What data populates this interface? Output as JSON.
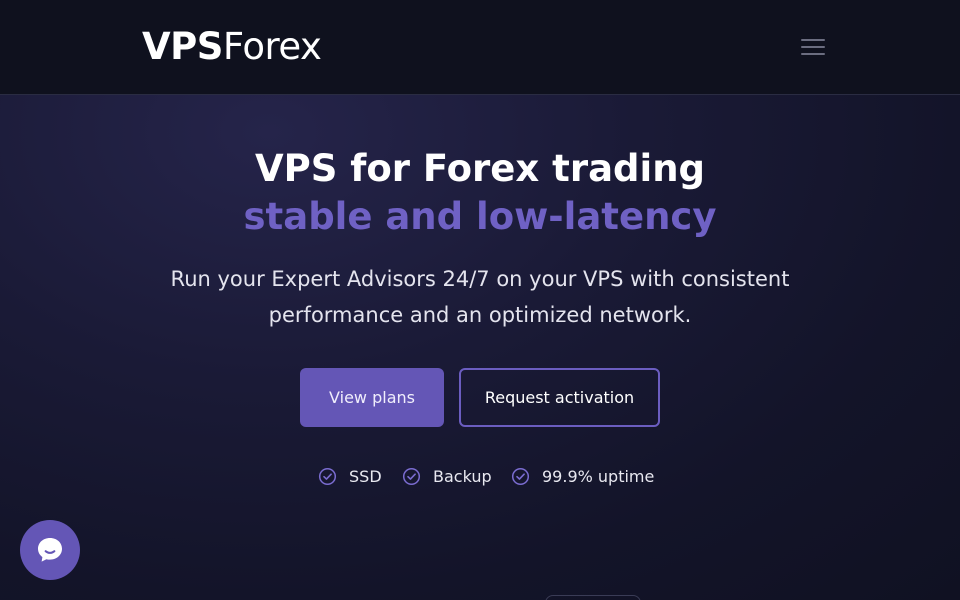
{
  "header": {
    "logo_bold": "VPS",
    "logo_light": "Forex",
    "menu_icon": "hamburger-menu-icon"
  },
  "hero": {
    "headline": "VPS for Forex trading",
    "headline_accent": "stable and low-latency",
    "subtext": "Run your Expert Advisors 24/7 on your VPS with consistent performance and an optimized network.",
    "primary_button": "View plans",
    "secondary_button": "Request activation",
    "features": [
      {
        "icon": "check-circle-icon",
        "label": "SSD"
      },
      {
        "icon": "check-circle-icon",
        "label": "Backup"
      },
      {
        "icon": "check-circle-icon",
        "label": "99.9% uptime"
      }
    ]
  },
  "chat": {
    "icon": "chat-bubble-icon"
  },
  "colors": {
    "accent": "#6456b6",
    "accent_text": "#6f61c4",
    "header_bg": "#0f111e",
    "page_bg": "#15162c"
  }
}
